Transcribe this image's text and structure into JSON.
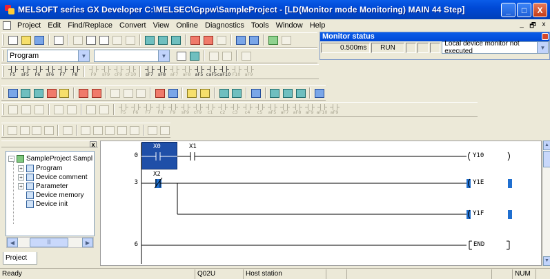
{
  "window": {
    "title": "MELSOFT series GX Developer C:\\MELSEC\\Gppw\\SampleProject - [LD(Monitor mode Monitoring)    MAIN    44 Step]",
    "min_glyph": "_",
    "max_glyph": "□",
    "close_glyph": "X"
  },
  "menu": {
    "items": [
      {
        "label": "Project"
      },
      {
        "label": "Edit"
      },
      {
        "label": "Find/Replace"
      },
      {
        "label": "Convert"
      },
      {
        "label": "View"
      },
      {
        "label": "Online"
      },
      {
        "label": "Diagnostics"
      },
      {
        "label": "Tools"
      },
      {
        "label": "Window"
      },
      {
        "label": "Help"
      }
    ],
    "mdi_min": "_",
    "mdi_restore": "🗗",
    "mdi_close": "x"
  },
  "toolbar": {
    "data_type_combo": "Program",
    "second_combo": "",
    "row3_keys": [
      "F5",
      "sF5",
      "F6",
      "sF6",
      "F7",
      "F8",
      "F9",
      "sF9",
      "cF9",
      "cF10",
      "sF7",
      "sF8",
      "aF7",
      "aF8",
      "aF5",
      "caF5",
      "caF10",
      "F10",
      "aF9"
    ],
    "row6_keys": [
      "F5",
      "F6",
      "F7",
      "F8",
      "F9",
      "sF9",
      "cF9",
      "c1",
      "c2",
      "c3",
      "c4",
      "c5",
      "aF5",
      "aF7",
      "aF8",
      "aF9",
      "aF10",
      "aF9"
    ]
  },
  "monitor_status": {
    "title": "Monitor status",
    "scan_time": "0.500ms",
    "run_state": "RUN",
    "local_monitor": "Local device monitor not executed"
  },
  "project_tree": {
    "root": "SampleProject Sampl",
    "items": [
      "Program",
      "Device comment",
      "Parameter",
      "Device memory",
      "Device init"
    ],
    "tab_label": "Project",
    "close_glyph": "x"
  },
  "ladder": {
    "steps": [
      "0",
      "3",
      "6"
    ],
    "contacts": {
      "x0": "X0",
      "x1": "X1",
      "x2": "X2"
    },
    "coils": {
      "y10": "Y10",
      "y1e": "Y1E",
      "y1f": "Y1F",
      "end": "END"
    }
  },
  "status_bar": {
    "state": "Ready",
    "cpu": "Q02U",
    "station": "Host station",
    "num": "NUM"
  },
  "colors": {
    "titlebar": "#0054e3",
    "monitor_cursor": "#1f4fa8",
    "coil_on": "#1f6fd0"
  }
}
